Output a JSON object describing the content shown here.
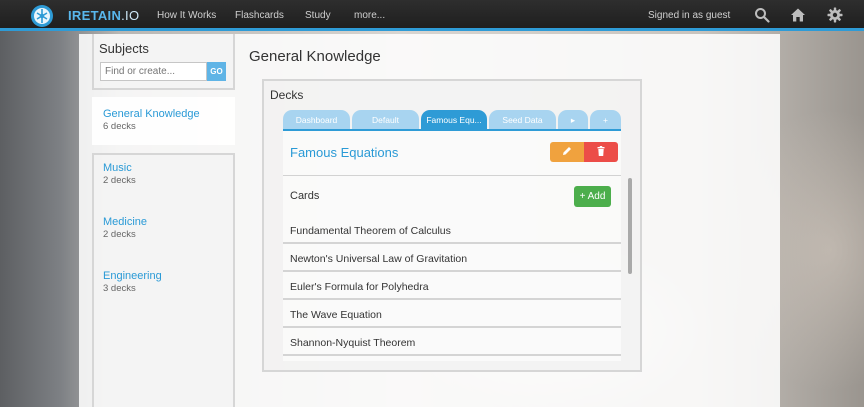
{
  "topbar": {
    "brand_main": "IRETAIN",
    "brand_suffix": ".IO",
    "nav": [
      {
        "label": "How It Works"
      },
      {
        "label": "Flashcards"
      },
      {
        "label": "Study"
      },
      {
        "label": "more..."
      }
    ],
    "signed_in": "Signed in as guest",
    "icons": [
      "search-icon",
      "home-icon",
      "gear-icon"
    ],
    "accent": "#2e9bd6"
  },
  "sidebar": {
    "title": "Subjects",
    "search_placeholder": "Find or create...",
    "go_label": "GO",
    "subjects": [
      {
        "name": "General Knowledge",
        "count": "6 decks"
      },
      {
        "name": "Music",
        "count": "2 decks"
      },
      {
        "name": "Medicine",
        "count": "2 decks"
      },
      {
        "name": "Engineering",
        "count": "3 decks"
      }
    ]
  },
  "main": {
    "title": "General Knowledge",
    "decks_title": "Decks",
    "tabs": [
      {
        "label": "Dashboard"
      },
      {
        "label": "Default"
      },
      {
        "label": "Famous Equ..."
      },
      {
        "label": "Seed Data"
      },
      {
        "label": "▸"
      },
      {
        "label": "+"
      }
    ],
    "deck": {
      "name": "Famous Equations",
      "cards_label": "Cards",
      "add_label": "+ Add",
      "cards": [
        "Fundamental Theorem of Calculus",
        "Newton's Universal Law of Gravitation",
        "Euler's Formula for Polyhedra",
        "The Wave Equation",
        "Shannon-Nyquist Theorem"
      ]
    }
  },
  "colors": {
    "link_blue": "#2a9ad6",
    "edit_orange": "#f0a23e",
    "delete_red": "#ec4d48",
    "add_green": "#4cae4c"
  }
}
